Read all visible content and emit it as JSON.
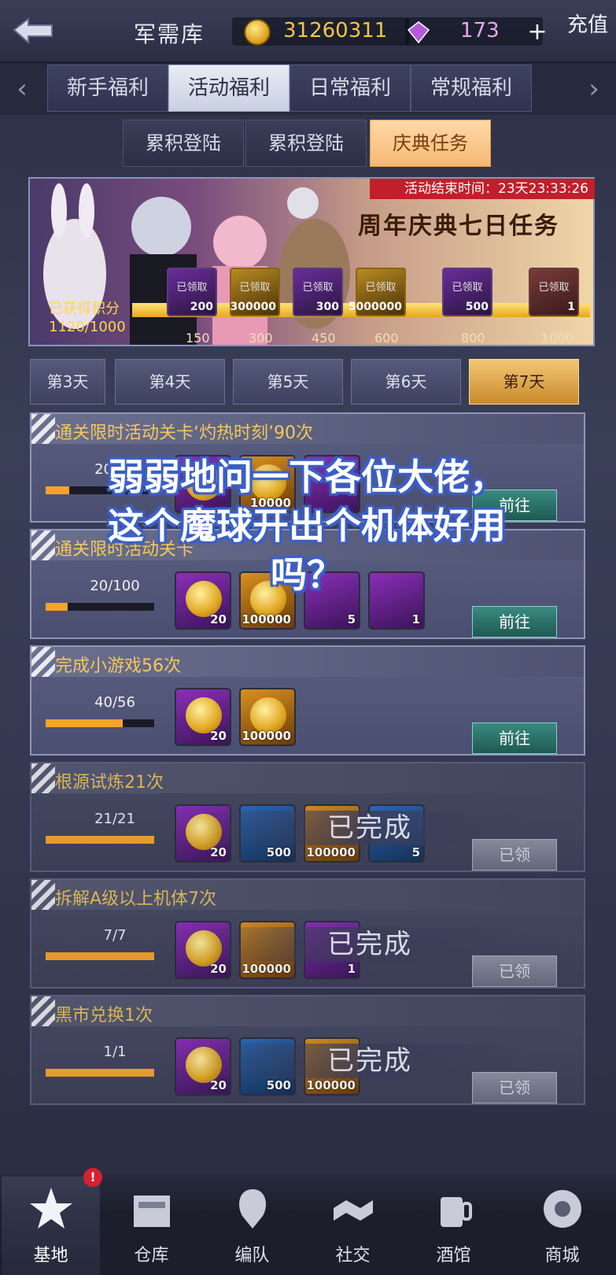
{
  "header": {
    "title": "军需库",
    "gold": "31260311",
    "gems": "173",
    "plus": "+",
    "recharge": "充值"
  },
  "main_tabs": [
    {
      "label": "新手福利"
    },
    {
      "label": "活动福利"
    },
    {
      "label": "日常福利"
    },
    {
      "label": "常规福利"
    }
  ],
  "sub_tabs": [
    {
      "label": "累积登陆"
    },
    {
      "label": "累积登陆"
    },
    {
      "label": "庆典任务"
    }
  ],
  "banner": {
    "countdown": "活动结束时间：23天23:33:26",
    "event_title": "周年庆典七日任务",
    "points_label": "已获得积分",
    "points_value": "1120/1000",
    "progress": 1.0,
    "milestones": [
      {
        "claimed": "已领取",
        "amount": "200",
        "tick": "150"
      },
      {
        "claimed": "已领取",
        "amount": "300000",
        "tick": "300"
      },
      {
        "claimed": "已领取",
        "amount": "300",
        "tick": "450"
      },
      {
        "claimed": "已领取",
        "amount": "5000000",
        "tick": "600"
      },
      {
        "claimed": "已领取",
        "amount": "500",
        "tick": "800"
      },
      {
        "claimed": "已领取",
        "amount": "1",
        "tick": "1000"
      }
    ]
  },
  "day_tabs": [
    {
      "label": "第3天"
    },
    {
      "label": "第4天"
    },
    {
      "label": "第5天"
    },
    {
      "label": "第6天"
    },
    {
      "label": "第7天"
    }
  ],
  "tasks": [
    {
      "title": "通关限时活动关卡‘灼热时刻’90次",
      "count": "20/90",
      "progress": 0.22,
      "button": "前往",
      "rewards": [
        "",
        "10000",
        ""
      ]
    },
    {
      "title": "通关限时活动关卡",
      "count": "20/100",
      "progress": 0.2,
      "button": "前往",
      "rewards": [
        "20",
        "100000",
        "5",
        "1"
      ]
    },
    {
      "title": "完成小游戏56次",
      "count": "40/56",
      "progress": 0.71,
      "button": "前往",
      "rewards": [
        "20",
        "100000"
      ]
    },
    {
      "title": "根源试炼21次",
      "count": "21/21",
      "progress": 1.0,
      "button": "已领",
      "stamp": "已完成",
      "rewards": [
        "20",
        "500",
        "100000",
        "5"
      ]
    },
    {
      "title": "拆解A级以上机体7次",
      "count": "7/7",
      "progress": 1.0,
      "button": "已领",
      "stamp": "已完成",
      "rewards": [
        "20",
        "100000",
        "1"
      ]
    },
    {
      "title": "黑市兑换1次",
      "count": "1/1",
      "progress": 1.0,
      "button": "已领",
      "stamp": "已完成",
      "rewards": [
        "20",
        "500",
        "100000"
      ]
    }
  ],
  "caption": {
    "line1": "弱弱地问一下各位大佬，",
    "line2": "这个魔球开出个机体好用",
    "line3": "吗？"
  },
  "bottom_nav": [
    {
      "label": "基地",
      "icon": "base-icon"
    },
    {
      "label": "仓库",
      "icon": "warehouse-icon"
    },
    {
      "label": "编队",
      "icon": "formation-icon"
    },
    {
      "label": "社交",
      "icon": "social-icon"
    },
    {
      "label": "酒馆",
      "icon": "tavern-icon"
    },
    {
      "label": "商城",
      "icon": "shop-icon"
    }
  ],
  "badge": "!",
  "colors": {
    "accent_gold": "#f3c44a",
    "go_button": "#2e7a70",
    "active_tab": "#f4c774"
  }
}
